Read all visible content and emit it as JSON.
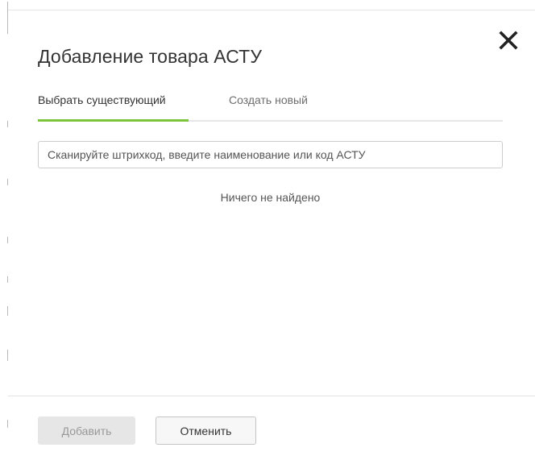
{
  "dialog": {
    "title": "Добавление товара АСТУ",
    "close_icon": "close-icon"
  },
  "tabs": [
    {
      "label": "Выбрать существующий",
      "active": true
    },
    {
      "label": "Создать новый",
      "active": false
    }
  ],
  "search": {
    "placeholder": "Сканируйте штрихкод, введите наименование или код АСТУ",
    "value": ""
  },
  "results": {
    "empty_text": "Ничего не найдено"
  },
  "footer": {
    "add_label": "Добавить",
    "cancel_label": "Отменить"
  },
  "colors": {
    "active_tab_underline": "#7cc43c",
    "disabled_button_bg": "#e6e6e6",
    "text": "#333333"
  }
}
